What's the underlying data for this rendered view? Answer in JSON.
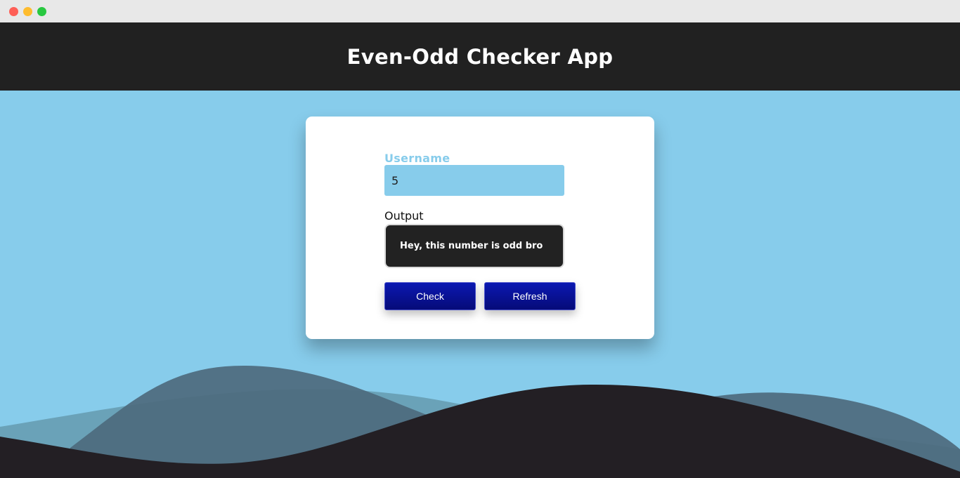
{
  "header": {
    "title": "Even-Odd Checker App"
  },
  "form": {
    "input_label": "Username",
    "input_value": "5",
    "output_label": "Output",
    "output_text": "Hey, this number is odd bro",
    "check_label": "Check",
    "refresh_label": "Refresh"
  },
  "colors": {
    "background": "#87cceb",
    "header": "#212121",
    "button": "#0a14a0",
    "output_box": "#222222"
  }
}
